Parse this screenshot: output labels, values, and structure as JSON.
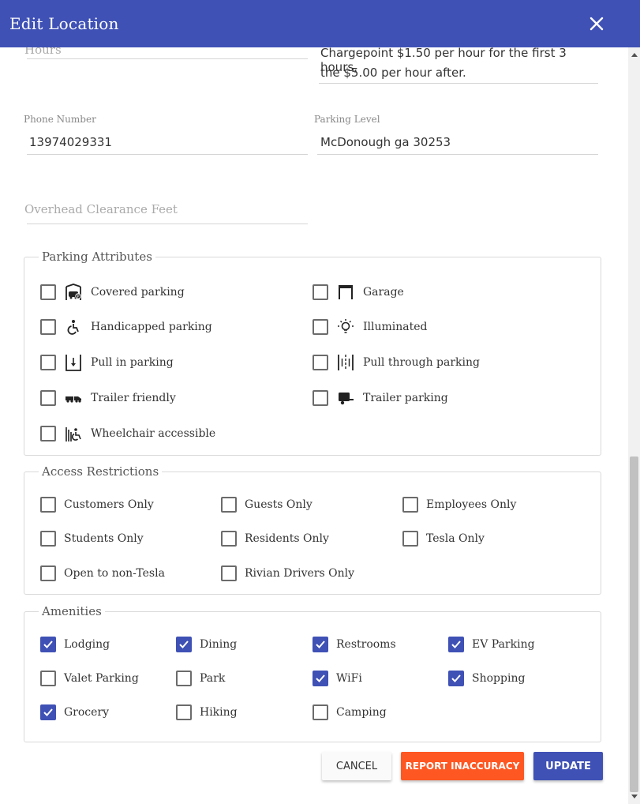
{
  "dialog": {
    "title": "Edit Location"
  },
  "fields": {
    "hours": {
      "placeholder": "Hours"
    },
    "pricing": {
      "line1": "Chargepoint $1.50 per hour for the first 3 hours,",
      "line2": "the $5.00 per hour after."
    },
    "phone": {
      "label": "Phone Number",
      "value": "13974029331"
    },
    "parking_level": {
      "label": "Parking Level",
      "value": "McDonough ga 30253"
    },
    "overhead": {
      "placeholder": "Overhead Clearance Feet"
    }
  },
  "parking_attributes": {
    "legend": "Parking Attributes",
    "items": [
      {
        "label": "Covered parking",
        "icon": "covered-parking-icon",
        "checked": false
      },
      {
        "label": "Garage",
        "icon": "garage-icon",
        "checked": false
      },
      {
        "label": "Handicapped parking",
        "icon": "accessible-icon",
        "checked": false
      },
      {
        "label": "Illuminated",
        "icon": "lightbulb-icon",
        "checked": false
      },
      {
        "label": "Pull in parking",
        "icon": "pull-in-icon",
        "checked": false
      },
      {
        "label": "Pull through parking",
        "icon": "pull-through-icon",
        "checked": false
      },
      {
        "label": "Trailer friendly",
        "icon": "truck-trailer-icon",
        "checked": false
      },
      {
        "label": "Trailer parking",
        "icon": "trailer-icon",
        "checked": false
      },
      {
        "label": "Wheelchair accessible",
        "icon": "wheelchair-ramp-icon",
        "checked": false
      }
    ]
  },
  "access_restrictions": {
    "legend": "Access Restrictions",
    "items": [
      {
        "label": "Customers Only",
        "checked": false
      },
      {
        "label": "Guests Only",
        "checked": false
      },
      {
        "label": "Employees Only",
        "checked": false
      },
      {
        "label": "Students Only",
        "checked": false
      },
      {
        "label": "Residents Only",
        "checked": false
      },
      {
        "label": "Tesla Only",
        "checked": false
      },
      {
        "label": "Open to non-Tesla",
        "checked": false
      },
      {
        "label": "Rivian Drivers Only",
        "checked": false
      }
    ]
  },
  "amenities": {
    "legend": "Amenities",
    "items": [
      {
        "label": "Lodging",
        "checked": true
      },
      {
        "label": "Dining",
        "checked": true
      },
      {
        "label": "Restrooms",
        "checked": true
      },
      {
        "label": "EV Parking",
        "checked": true
      },
      {
        "label": "Valet Parking",
        "checked": false
      },
      {
        "label": "Park",
        "checked": false
      },
      {
        "label": "WiFi",
        "checked": true
      },
      {
        "label": "Shopping",
        "checked": true
      },
      {
        "label": "Grocery",
        "checked": true
      },
      {
        "label": "Hiking",
        "checked": false
      },
      {
        "label": "Camping",
        "checked": false
      }
    ]
  },
  "actions": {
    "cancel": "CANCEL",
    "report": "REPORT INACCURACY",
    "update": "UPDATE"
  },
  "colors": {
    "primary": "#3f51b5",
    "accent": "#ff5722"
  }
}
